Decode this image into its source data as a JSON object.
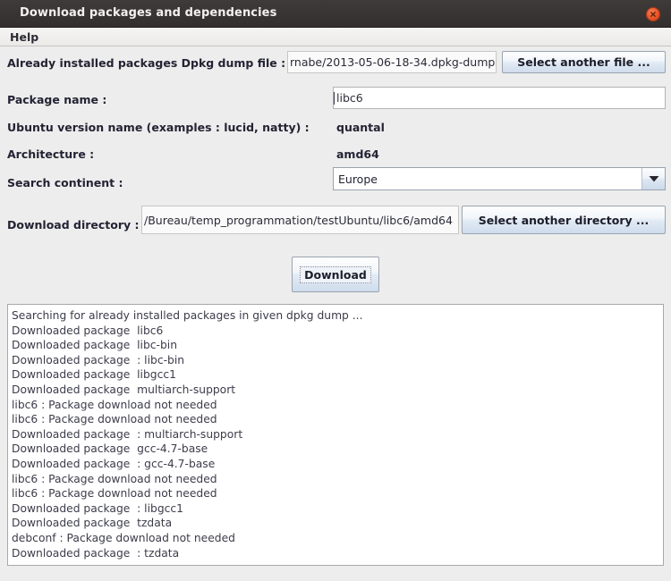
{
  "window": {
    "title": "Download packages and dependencies",
    "close_icon": "close-icon"
  },
  "menubar": {
    "items": [
      {
        "label": "Help"
      }
    ]
  },
  "form": {
    "dpkg_dump": {
      "label": "Already installed packages Dpkg dump file :",
      "value": "rnabe/2013-05-06-18-34.dpkg-dump",
      "button_label": "Select another file ..."
    },
    "package_name": {
      "label": "Package name :",
      "value": "libc6"
    },
    "ubuntu_version": {
      "label": "Ubuntu version name (examples : lucid, natty) :",
      "value": "quantal"
    },
    "architecture": {
      "label": "Architecture :",
      "value": "amd64"
    },
    "search_continent": {
      "label": "Search continent :",
      "value": "Europe",
      "options": [
        "Europe"
      ],
      "arrow_icon": "chevron-down-icon"
    },
    "download_directory": {
      "label": "Download directory :",
      "value": "/Bureau/temp_programmation/testUbuntu/libc6/amd64",
      "button_label": "Select another directory ..."
    },
    "download_button": {
      "label": "Download"
    }
  },
  "log": {
    "lines": [
      "Searching for already installed packages in given dpkg dump ...",
      "Downloaded package  libc6",
      "Downloaded package  libc-bin",
      "Downloaded package  : libc-bin",
      "Downloaded package  libgcc1",
      "Downloaded package  multiarch-support",
      "libc6 : Package download not needed",
      "libc6 : Package download not needed",
      "Downloaded package  : multiarch-support",
      "Downloaded package  gcc-4.7-base",
      "Downloaded package  : gcc-4.7-base",
      "libc6 : Package download not needed",
      "libc6 : Package download not needed",
      "Downloaded package  : libgcc1",
      "Downloaded package  tzdata",
      "debconf : Package download not needed",
      "Downloaded package  : tzdata"
    ]
  },
  "colors": {
    "titlebar": "#383433",
    "close_button": "#e8552a",
    "panel_bg": "#ededed",
    "button_accent": "#cfdcec"
  }
}
